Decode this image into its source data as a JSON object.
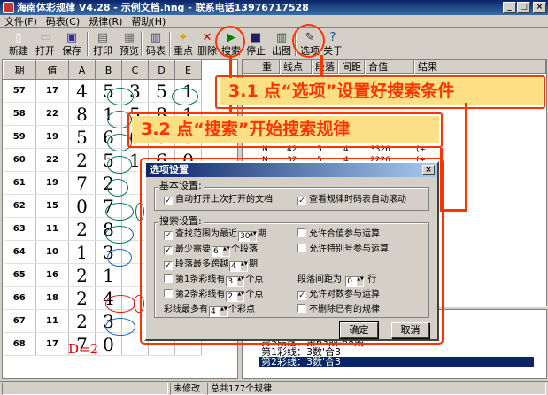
{
  "window": {
    "title": "海南体彩规律 V4.28 - 示例文档.hng - 联系电话13976717528",
    "minimize": "_",
    "maximize": "□",
    "close": "×"
  },
  "menu": [
    "文件(F)",
    "码表(C)",
    "规律(R)",
    "帮助(H)"
  ],
  "toolbar": [
    {
      "label": "新建",
      "icon": "new-doc-icon",
      "glyph": "▯",
      "color": "#ffffff"
    },
    {
      "label": "打开",
      "icon": "folder-icon",
      "glyph": "▭",
      "color": "#e0b030"
    },
    {
      "label": "保存",
      "icon": "save-icon",
      "glyph": "▣",
      "color": "#303090"
    },
    {
      "label": "打印",
      "icon": "printer-icon",
      "glyph": "▤",
      "color": "#606060"
    },
    {
      "label": "预览",
      "icon": "preview-icon",
      "glyph": "▦",
      "color": "#707070"
    },
    {
      "label": "码表",
      "icon": "table-icon",
      "glyph": "▥",
      "color": "#404080"
    },
    {
      "label": "重点",
      "icon": "star-icon",
      "glyph": "✦",
      "color": "#e0a000"
    },
    {
      "label": "删除",
      "icon": "delete-icon",
      "glyph": "✕",
      "color": "#c00000"
    },
    {
      "label": "搜索",
      "icon": "search-play-icon",
      "glyph": "▶",
      "color": "#008000"
    },
    {
      "label": "停止",
      "icon": "stop-icon",
      "glyph": "■",
      "color": "#202060"
    },
    {
      "label": "出图",
      "icon": "chart-icon",
      "glyph": "▥",
      "color": "#306030"
    },
    {
      "label": "选项",
      "icon": "options-icon",
      "glyph": "✎",
      "color": "#303030"
    },
    {
      "label": "关于",
      "icon": "about-icon",
      "glyph": "?",
      "color": "#0050a0"
    }
  ],
  "grid": {
    "headers": [
      "期",
      "值",
      "A",
      "B",
      "C",
      "D",
      "E"
    ],
    "rows": [
      [
        "57",
        "17",
        "4",
        "5",
        "3",
        "5",
        "1"
      ],
      [
        "58",
        "22",
        "8",
        "1",
        "5",
        "8",
        "1"
      ],
      [
        "59",
        "19",
        "5",
        "6",
        "0",
        "3",
        "5"
      ],
      [
        "60",
        "22",
        "2",
        "5",
        "1",
        "6",
        "0"
      ],
      [
        "61",
        "19",
        "7",
        "2",
        "",
        "",
        ""
      ],
      [
        "62",
        "15",
        "0",
        "7",
        "",
        "",
        ""
      ],
      [
        "63",
        "11",
        "2",
        "8",
        "",
        "",
        ""
      ],
      [
        "64",
        "10",
        "1",
        "3",
        "",
        "",
        ""
      ],
      [
        "65",
        "16",
        "2",
        "1",
        "",
        "",
        ""
      ],
      [
        "66",
        "18",
        "2",
        "4",
        "",
        "",
        ""
      ],
      [
        "67",
        "11",
        "2",
        "3",
        "",
        "",
        ""
      ],
      [
        "68",
        "17",
        "7",
        "0",
        "",
        "",
        ""
      ]
    ],
    "d_label": "D=2"
  },
  "results": {
    "headers": [
      "重",
      "线点",
      "段落",
      "间距",
      "合值",
      "结果"
    ],
    "rows": [
      {
        "cols": [
          "N",
          "42",
          "5",
          "4",
          "3326",
          "(+"
        ]
      },
      {
        "cols": [
          "N",
          "32",
          "5",
          "4",
          "2226",
          "(+"
        ]
      },
      {
        "cols": [
          "N",
          "36",
          "5",
          "4",
          "3225",
          "(+"
        ]
      }
    ],
    "bottom_list": [
      "第5段落：第63期-68期",
      "第1彩线：3数'合3",
      "第2彩线：3数'合3"
    ]
  },
  "dialog": {
    "title": "选项设置",
    "close": "×",
    "basic_group": "基本设置:",
    "basic": [
      {
        "label": "自动打开上次打开的文档",
        "checked": true
      },
      {
        "label": "查看规律时码表自动滚动",
        "checked": true
      }
    ],
    "search_group": "搜索设置:",
    "search": {
      "range_pre": "查找范围为最近",
      "range_val": "30",
      "range_post": "期",
      "range_checked": true,
      "min_pre": "最少需要",
      "min_val": "6",
      "min_post": "个段落",
      "min_checked": true,
      "span_pre": "段落最多跨越",
      "span_val": "4",
      "span_post": "期",
      "span_checked": true,
      "c1_pre": "第1条彩线有",
      "c1_val": "3",
      "c1_post": "个点",
      "c1_checked": false,
      "c2_pre": "第2条彩线有",
      "c2_val": "2",
      "c2_post": "个点",
      "c2_checked": false,
      "max_pre": "彩线最多有",
      "max_val": "4",
      "max_post": "个彩点",
      "allow_sum": {
        "label": "允许合值参与运算",
        "checked": false
      },
      "allow_special": {
        "label": "允许特别号参与运算",
        "checked": false
      },
      "gap_pre": "段落间距为",
      "gap_val": "0",
      "gap_post": "行",
      "allow_pairs": {
        "label": "允许对数参与运算",
        "checked": true
      },
      "no_delete": {
        "label": "不删除已有的规律",
        "checked": false
      }
    },
    "ok": "确定",
    "cancel": "取消",
    "checkmark": "✓",
    "spin_arrows": "▲▼"
  },
  "callouts": {
    "step1": "3.1 点“选项”设置好搜索条件",
    "step2": "3.2 点“搜索”开始搜索规律"
  },
  "status": {
    "p1": "",
    "p2": "未修改",
    "p3": "总共177个规律"
  },
  "colors": {
    "teal_circle": "#007060",
    "blue_circle": "#1060d0",
    "red_circle": "#e01010",
    "annotation": "#ff3300",
    "callout_bg": "#fde086"
  }
}
